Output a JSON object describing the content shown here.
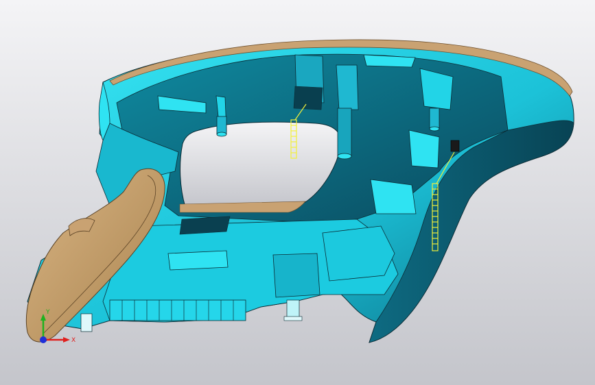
{
  "viewport": {
    "background_top": "#f4f4f6",
    "background_bottom": "#c4c5cb"
  },
  "model": {
    "colors": {
      "surface_light": "#2fe3f2",
      "surface_mid": "#19b8cf",
      "surface_dark": "#0c6f86",
      "surface_deep": "#0a4e63",
      "edge": "#0b2a33",
      "trim_tan": "#c9a272",
      "trim_tan_dark": "#8c6a43",
      "marker_yellow": "#f2f03a"
    }
  },
  "triad": {
    "x_label": "X",
    "y_label": "Y",
    "x_color": "#e0201e",
    "y_color": "#1fb21f",
    "z_color": "#1e2fd8"
  }
}
